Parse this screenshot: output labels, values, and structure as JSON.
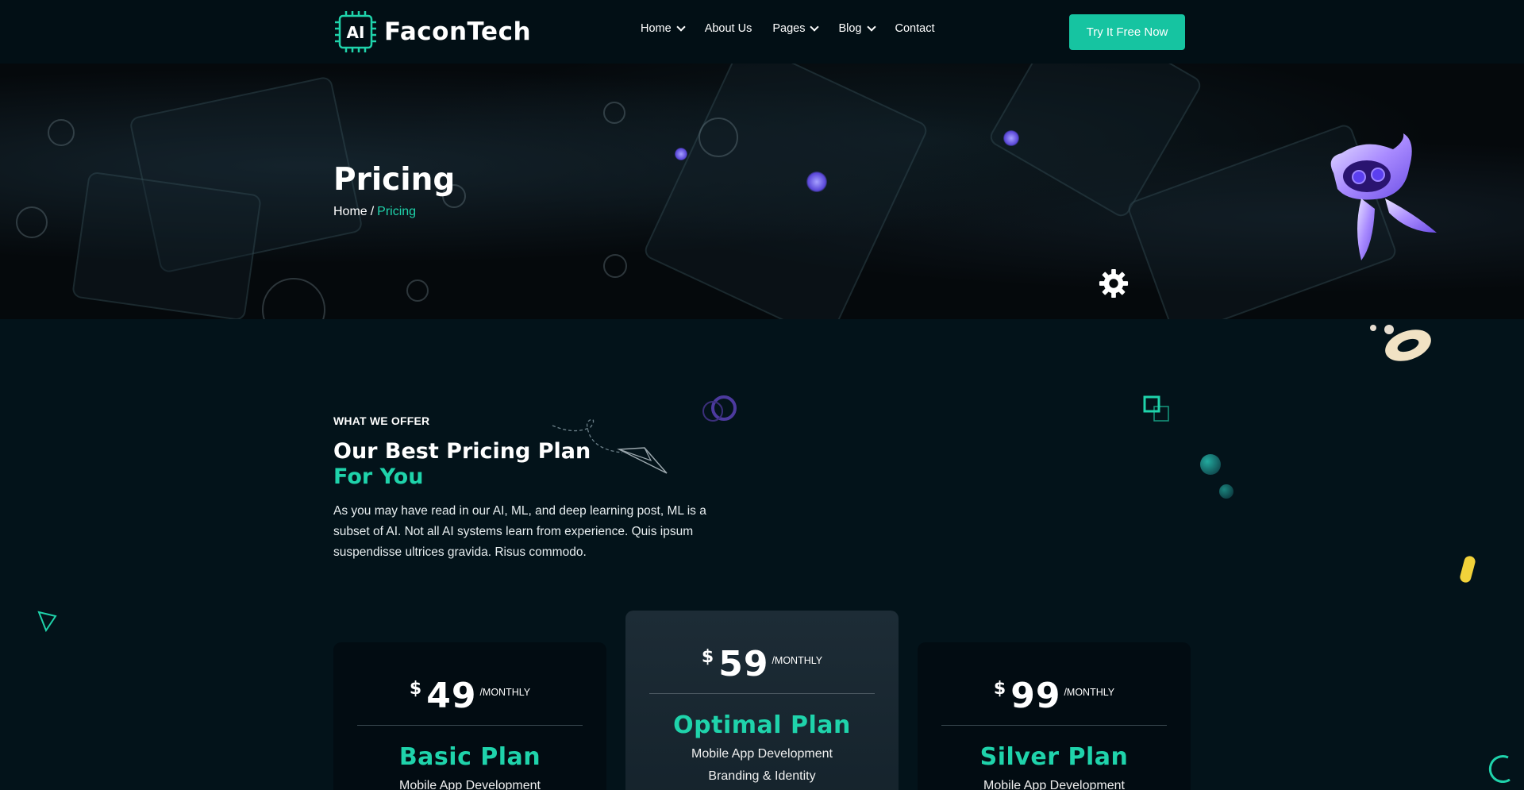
{
  "brand": {
    "logo_chip": "AI",
    "name": "FaconTech"
  },
  "nav": {
    "items": [
      {
        "label": "Home",
        "has_dropdown": true
      },
      {
        "label": "About Us",
        "has_dropdown": false
      },
      {
        "label": "Pages",
        "has_dropdown": true
      },
      {
        "label": "Blog",
        "has_dropdown": true
      },
      {
        "label": "Contact",
        "has_dropdown": false
      }
    ],
    "cta_label": "Try It Free Now"
  },
  "hero": {
    "title": "Pricing",
    "breadcrumb": {
      "home": "Home",
      "separator": "/",
      "current": "Pricing"
    }
  },
  "section": {
    "eyebrow": "WHAT WE OFFER",
    "title_line1": "Our Best Pricing Plan",
    "title_line2": "For You",
    "description": "As you may have read in our AI, ML, and deep learning post, ML is a subset of AI. Not all AI systems learn from experience. Quis ipsum suspendisse ultrices gravida. Risus commodo."
  },
  "plans": [
    {
      "currency": "$",
      "amount": "49",
      "period": "/MONTHLY",
      "name": "Basic Plan",
      "features": [
        "Mobile App Development"
      ]
    },
    {
      "currency": "$",
      "amount": "59",
      "period": "/MONTHLY",
      "name": "Optimal Plan",
      "features": [
        "Mobile App Development",
        "Branding & Identity"
      ]
    },
    {
      "currency": "$",
      "amount": "99",
      "period": "/MONTHLY",
      "name": "Silver Plan",
      "features": [
        "Mobile App Development"
      ]
    }
  ],
  "colors": {
    "accent": "#16c4a1",
    "accent_text": "#1fd3ab",
    "background": "#03131a",
    "header": "#020f15"
  },
  "icons": [
    "chip-icon",
    "chevron-down-icon",
    "gear-icon",
    "paper-plane-icon",
    "triangle-icon",
    "robot-illustration"
  ]
}
